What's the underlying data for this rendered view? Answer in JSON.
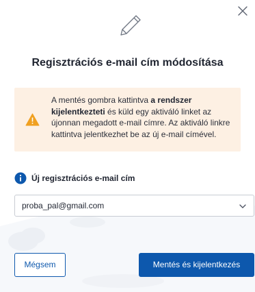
{
  "dialog": {
    "title": "Regisztrációs e-mail cím módosítása",
    "close_icon": "close-icon",
    "header_icon": "pencil-icon"
  },
  "warning": {
    "icon": "warning-triangle-icon",
    "text_before": "A mentés gombra kattintva ",
    "text_bold": "a rendszer kijelentkezteti",
    "text_after": " és küld egy aktiváló linket az újonnan megadott e-mail címre. Az aktiváló linkre kattintva jelentkezhet be az új e-mail címével.",
    "accent": "#f0a020",
    "background": "#fdf0e3"
  },
  "email_field": {
    "info_icon": "info-icon",
    "label": "Új regisztrációs e-mail cím",
    "value": "proba_pal@gmail.com"
  },
  "actions": {
    "cancel_label": "Mégsem",
    "confirm_label": "Mentés és kijelentkezés",
    "primary_color": "#0d58ad"
  }
}
